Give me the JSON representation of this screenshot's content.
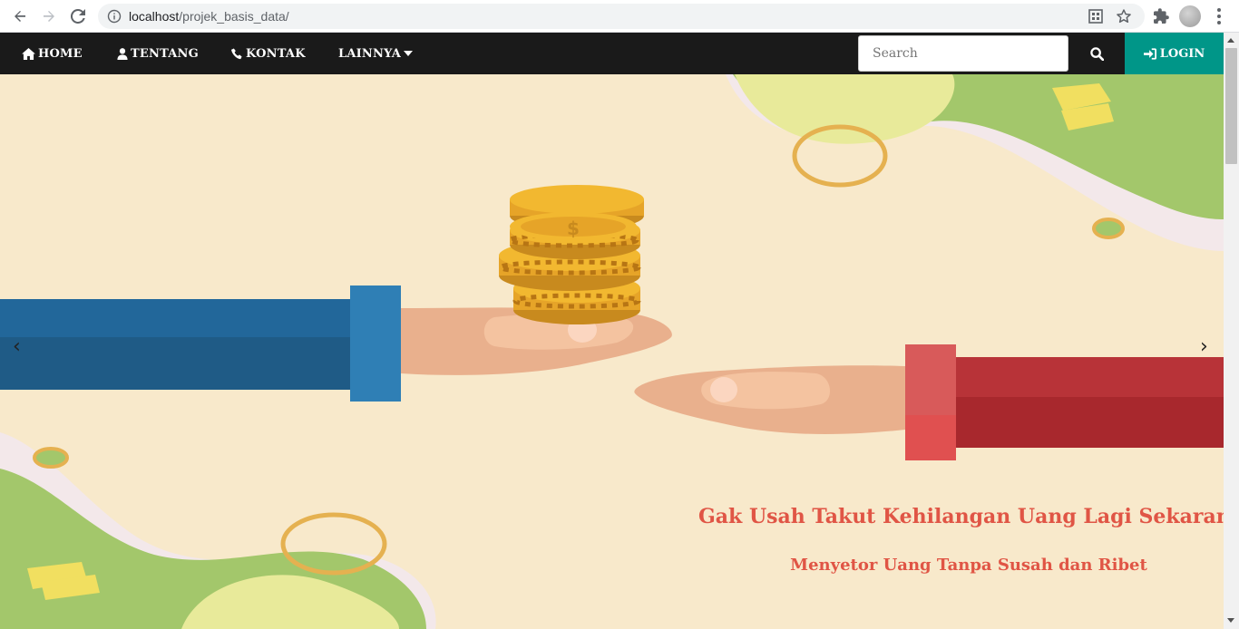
{
  "browser": {
    "url_host": "localhost",
    "url_path": "/projek_basis_data/"
  },
  "navbar": {
    "items": [
      {
        "label": "HOME",
        "icon": "home-icon"
      },
      {
        "label": "TENTANG",
        "icon": "user-icon"
      },
      {
        "label": "KONTAK",
        "icon": "phone-icon"
      },
      {
        "label": "LAINNYA",
        "icon": "caret-down-icon"
      }
    ],
    "search_placeholder": "Search",
    "login_label": "LOGIN"
  },
  "hero": {
    "prev_arrow": "‹",
    "next_arrow": "›",
    "headline": "Gak Usah Takut Kehilangan Uang Lagi Sekarang!",
    "subheadline": "Menyetor Uang Tanpa Susah dan Ribet"
  },
  "colors": {
    "navbar_bg": "#1a1a1a",
    "login_bg": "#009688",
    "hero_bg": "#f8e9cb",
    "caption": "#e05545"
  }
}
